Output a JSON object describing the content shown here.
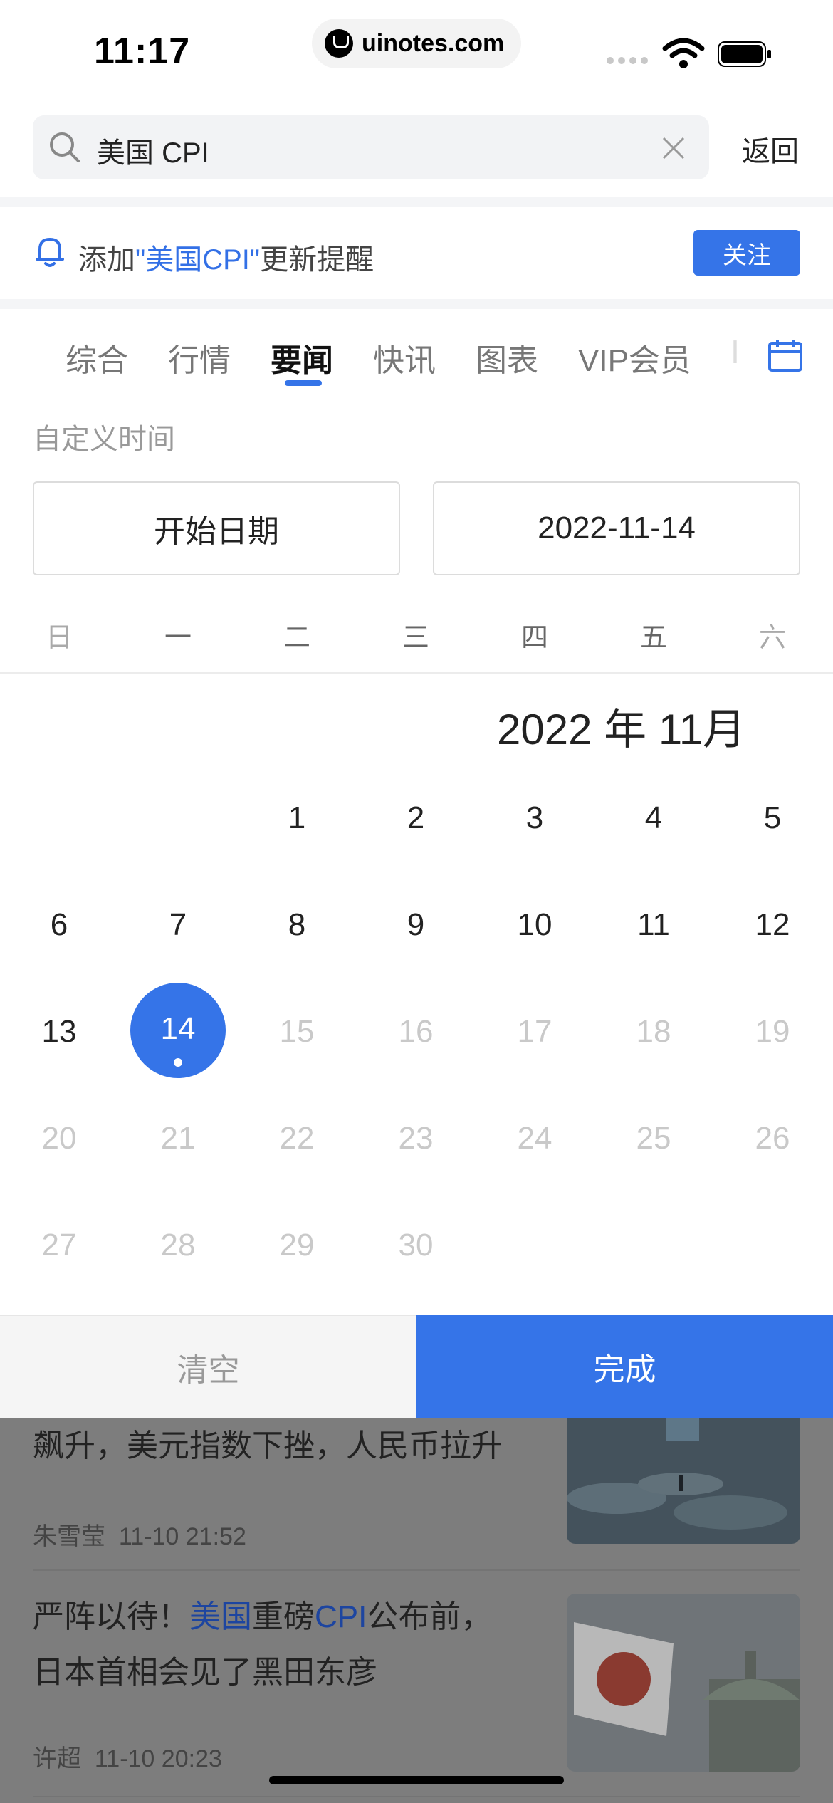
{
  "status_bar": {
    "time": "11:17",
    "url": "uinotes.com"
  },
  "search": {
    "query": "美国 CPI",
    "back_label": "返回"
  },
  "reminder": {
    "prefix": "添加",
    "keyword": "\"美国CPI\"",
    "suffix": "更新提醒",
    "follow_label": "关注"
  },
  "tabs": [
    {
      "label": "综合"
    },
    {
      "label": "行情"
    },
    {
      "label": "要闻",
      "active": true
    },
    {
      "label": "快讯"
    },
    {
      "label": "图表"
    },
    {
      "label": "VIP会员"
    },
    {
      "label": "Ⅰ"
    }
  ],
  "date_picker": {
    "custom_time_label": "自定义时间",
    "start_date_placeholder": "开始日期",
    "end_date_value": "2022-11-14",
    "weekdays": [
      "日",
      "一",
      "二",
      "三",
      "四",
      "五",
      "六"
    ],
    "month_title": "2022 年 11月",
    "selected_day": "14",
    "days": [
      "1",
      "2",
      "3",
      "4",
      "5",
      "6",
      "7",
      "8",
      "9",
      "10",
      "11",
      "12",
      "13",
      "14",
      "15",
      "16",
      "17",
      "18",
      "19",
      "20",
      "21",
      "22",
      "23",
      "24",
      "25",
      "26",
      "27",
      "28",
      "29",
      "30"
    ],
    "clear_label": "清空",
    "done_label": "完成"
  },
  "news": [
    {
      "title": "飙升，美元指数下挫，人民币拉升",
      "author": "朱雪莹",
      "time": "11-10 21:52"
    },
    {
      "title_parts": [
        "严阵以待！",
        "美国",
        "重磅",
        "CPI",
        "公布前，"
      ],
      "title_line2": "日本首相会见了黑田东彦",
      "author": "许超",
      "time": "11-10 20:23"
    }
  ],
  "colors": {
    "accent": "#3574e8",
    "keyword": "#3370e6"
  }
}
